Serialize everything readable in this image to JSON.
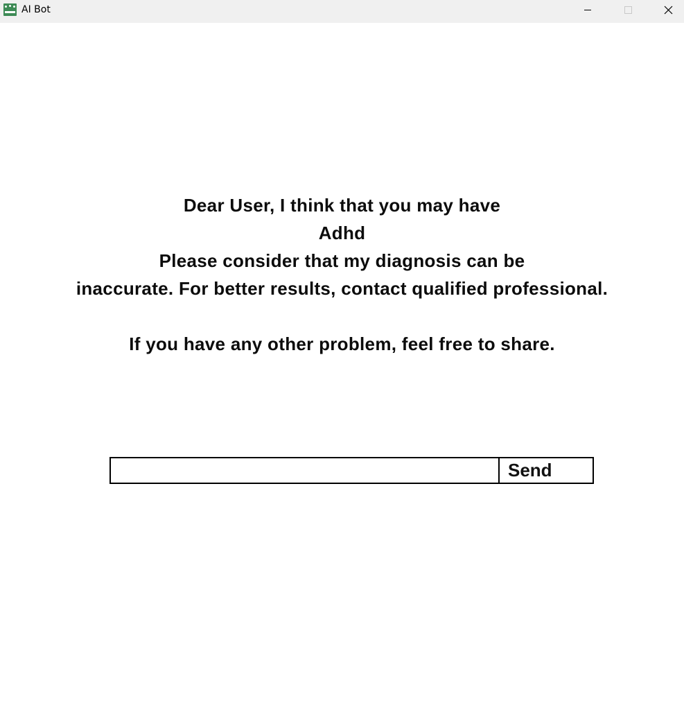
{
  "window": {
    "title": "AI Bot",
    "app_icon": "chatbot-app-icon",
    "controls": {
      "minimize_icon": "minimize-icon",
      "maximize_icon": "maximize-icon",
      "close_icon": "close-icon"
    }
  },
  "response": {
    "line1": "Dear User, I think that you may have",
    "line2": "Adhd",
    "line3": "Please consider that my diagnosis can be",
    "line4": "inaccurate. For better results, contact qualified professional.",
    "line5": "If you have any other problem, feel free to share."
  },
  "chat": {
    "input_value": "",
    "send_label": "Send"
  },
  "colors": {
    "titlebar": "#f0f0f0",
    "app_icon": "#3d8a55",
    "text": "#0c0c0c",
    "border": "#000000"
  }
}
